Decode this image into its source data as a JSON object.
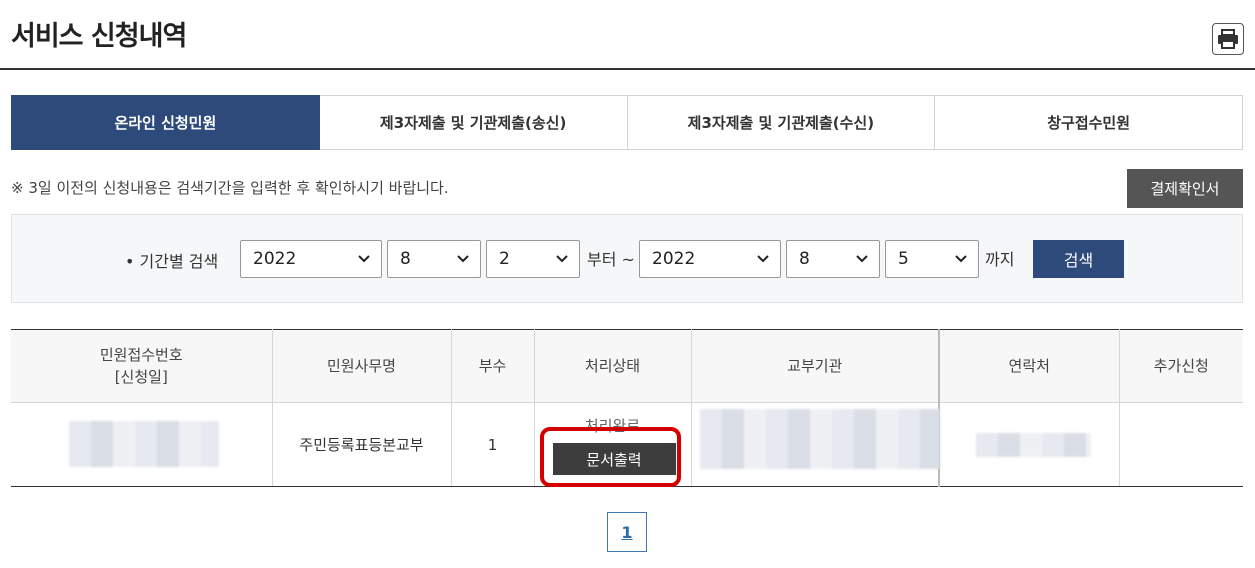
{
  "header": {
    "title": "서비스 신청내역",
    "print_icon": "printer-icon"
  },
  "tabs": [
    {
      "label": "온라인 신청민원",
      "active": true
    },
    {
      "label": "제3자제출 및 기관제출(송신)",
      "active": false
    },
    {
      "label": "제3자제출 및 기관제출(수신)",
      "active": false
    },
    {
      "label": "창구접수민원",
      "active": false
    }
  ],
  "notice": "※ 3일 이전의 신청내용은 검색기간을 입력한 후 확인하시기 바랍니다.",
  "receipt_button": "결제확인서",
  "search": {
    "label": "• 기간별 검색",
    "from_year": "2022",
    "from_month": "8",
    "from_day": "2",
    "from_text": "부터 ~",
    "to_year": "2022",
    "to_month": "8",
    "to_day": "5",
    "to_text": "까지",
    "button": "검색"
  },
  "table": {
    "headers": [
      "민원접수번호",
      "[신청일]",
      "민원사무명",
      "부수",
      "처리상태",
      "교부기관",
      "연락처",
      "추가신청"
    ],
    "rows": [
      {
        "service_name": "주민등록표등본교부",
        "copies": "1",
        "status": "처리완료",
        "print_button": "문서출력"
      }
    ]
  },
  "pagination": {
    "current": "1"
  },
  "colors": {
    "primary": "#2d4a7b",
    "highlight": "#d40000",
    "dark_button": "#3d3d3d"
  }
}
